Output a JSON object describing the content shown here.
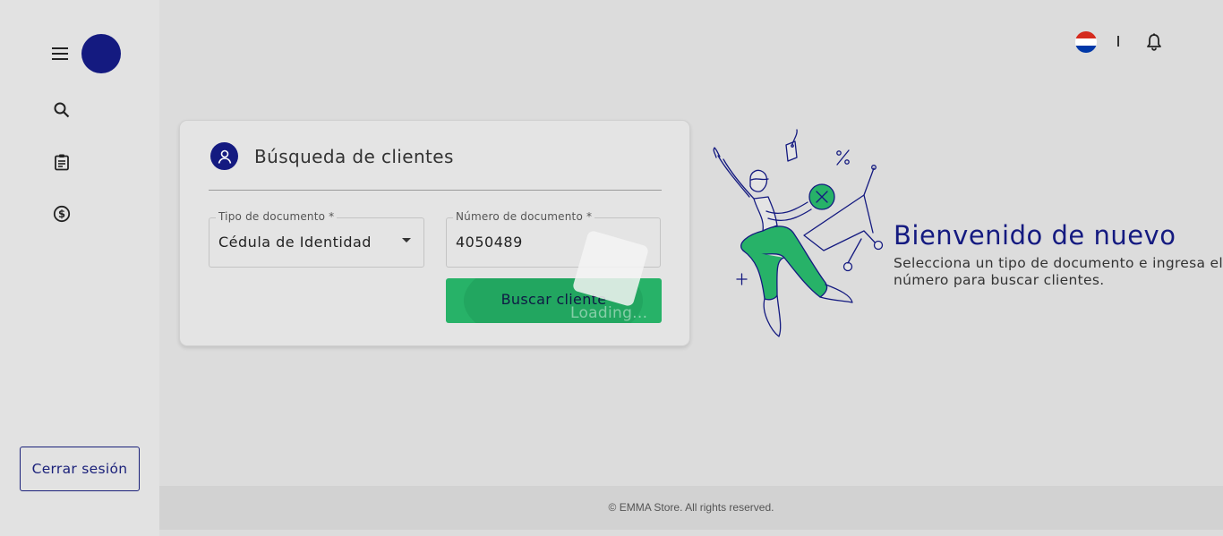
{
  "sidebar": {
    "nav_icons": [
      "search-icon",
      "clipboard-icon",
      "dollar-icon"
    ],
    "logout_label": "Cerrar sesión"
  },
  "topbar": {
    "separator": "|"
  },
  "search_card": {
    "title": "Búsqueda de clientes",
    "document_type": {
      "label": "Tipo de documento *",
      "value": "Cédula de Identidad"
    },
    "document_number": {
      "label": "Número de documento *",
      "value": "4050489"
    },
    "search_button_label": "Buscar cliente",
    "loading_text": "Loading..."
  },
  "welcome": {
    "title": "Bienvenido de nuevo",
    "subtitle": "Selecciona un tipo de documento e ingresa el número para buscar clientes."
  },
  "footer": {
    "text": "© EMMA Store. All rights reserved."
  },
  "colors": {
    "brand": "#141a80",
    "accent": "#27b268",
    "background": "#dcdcdc"
  }
}
